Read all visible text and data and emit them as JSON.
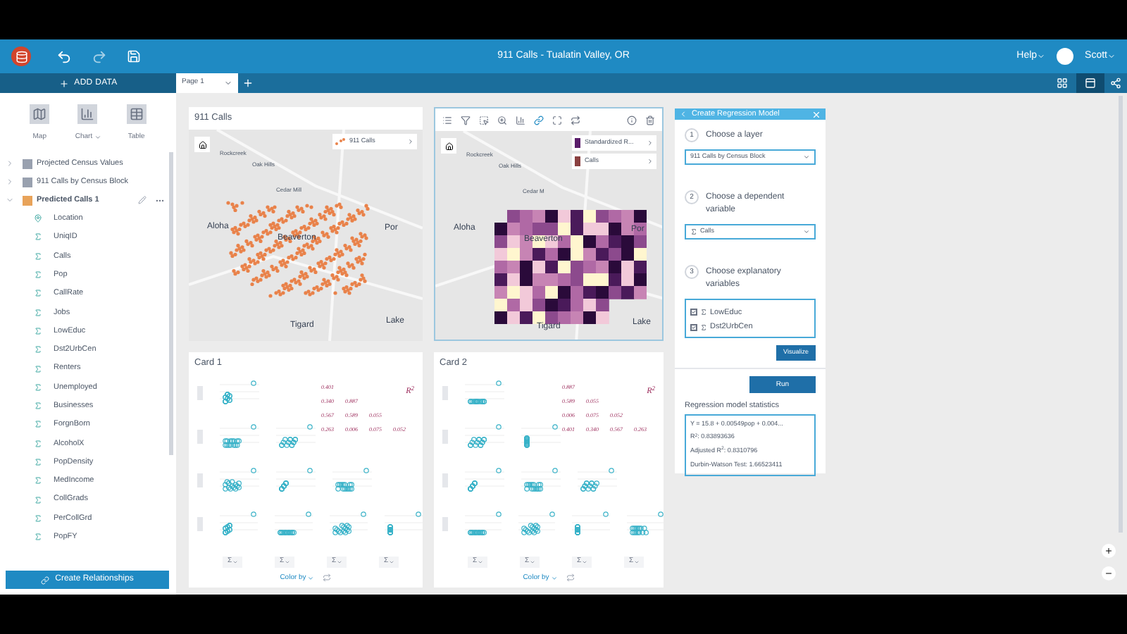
{
  "header": {
    "title": "911 Calls - Tualatin Valley, OR",
    "help": "Help",
    "user": "Scott"
  },
  "toolbar": {
    "add_data": "ADD DATA",
    "pages": [
      {
        "label": "Page 1",
        "selected": true
      }
    ]
  },
  "sidebar": {
    "viz_buttons": [
      {
        "label": "Map",
        "kind": "map"
      },
      {
        "label": "Chart",
        "kind": "chart"
      },
      {
        "label": "Table",
        "kind": "table"
      }
    ],
    "datasets": [
      {
        "name": "Projected Census Values",
        "expanded": false
      },
      {
        "name": "911 Calls by Census Block",
        "expanded": false
      },
      {
        "name": "Predicted Calls 1",
        "expanded": true,
        "fields": [
          {
            "name": "Location",
            "kind": "location"
          },
          {
            "name": "UniqID",
            "kind": "number"
          },
          {
            "name": "Calls",
            "kind": "number"
          },
          {
            "name": "Pop",
            "kind": "number"
          },
          {
            "name": "CallRate",
            "kind": "number"
          },
          {
            "name": "Jobs",
            "kind": "number"
          },
          {
            "name": "LowEduc",
            "kind": "number"
          },
          {
            "name": "Dst2UrbCen",
            "kind": "number"
          },
          {
            "name": "Renters",
            "kind": "number"
          },
          {
            "name": "Unemployed",
            "kind": "number"
          },
          {
            "name": "Businesses",
            "kind": "number"
          },
          {
            "name": "ForgnBorn",
            "kind": "number"
          },
          {
            "name": "AlcoholX",
            "kind": "number"
          },
          {
            "name": "PopDensity",
            "kind": "number"
          },
          {
            "name": "MedIncome",
            "kind": "number"
          },
          {
            "name": "CollGrads",
            "kind": "number"
          },
          {
            "name": "PerCollGrd",
            "kind": "number"
          },
          {
            "name": "PopFY",
            "kind": "number"
          }
        ]
      }
    ],
    "create_button": "Create Relationships"
  },
  "maps": [
    {
      "title": "911 Calls",
      "kind": "points",
      "labels": [
        "Rockcreek",
        "Oak Hills",
        "Cedar Mill",
        "Aloha",
        "Por",
        "Beaverton",
        "Tigard",
        "Lake"
      ],
      "legend": [
        {
          "label": "911 Calls",
          "kind": "points"
        }
      ]
    },
    {
      "kind": "choropleth",
      "labels": [
        "Rockcreek",
        "Oak Hills",
        "Cedar M",
        "Aloha",
        "Por",
        "Beaverton",
        "Tigard",
        "Lake"
      ],
      "legend": [
        {
          "label": "Standardized R...",
          "kind": "purple"
        },
        {
          "label": "Calls",
          "kind": "brown"
        }
      ]
    }
  ],
  "matrix_cards": [
    {
      "title": "Card 1",
      "r2_label": "R$^{2}$",
      "correlations": [
        [
          "0.401"
        ],
        [
          "0.340",
          "0.887"
        ],
        [
          "0.567",
          "0.589",
          "0.055"
        ],
        [
          "0.263",
          "0.006",
          "0.075",
          "0.052"
        ]
      ],
      "axis_buttons": [
        "Σ",
        "Σ",
        "Σ",
        "Σ"
      ],
      "color_by": "Color by"
    },
    {
      "title": "Card 2",
      "r2_label": "R$^{2}$",
      "correlations": [
        [
          "0.887"
        ],
        [
          "0.589",
          "0.055"
        ],
        [
          "0.006",
          "0.075",
          "0.052"
        ],
        [
          "0.401",
          "0.340",
          "0.567",
          "0.263"
        ]
      ],
      "axis_buttons": [
        "Σ",
        "Σ",
        "Σ",
        "Σ"
      ],
      "color_by": "Color by"
    }
  ],
  "regression": {
    "title": "Create Regression Model",
    "steps": [
      {
        "number": "1",
        "label": "Choose a layer"
      },
      {
        "number": "2",
        "label": "Choose a dependent variable"
      },
      {
        "number": "3",
        "label": "Choose explanatory variables"
      }
    ],
    "layer": "911 Calls by Census Block",
    "dependent": "Calls",
    "explanatory": [
      {
        "name": "LowEduc",
        "checked": true
      },
      {
        "name": "Dst2UrbCen",
        "checked": true
      }
    ],
    "visualize": "Visualize",
    "run": "Run",
    "stats_title": "Regression model statistics",
    "stats": [
      "Y = 15.8 + 0.00549pop + 0.004...",
      "R$^{2}$: 0.83893636",
      "Adjusted R$^{2}$: 0.8310796",
      "Durbin-Watson Test: 1.66523411"
    ]
  }
}
